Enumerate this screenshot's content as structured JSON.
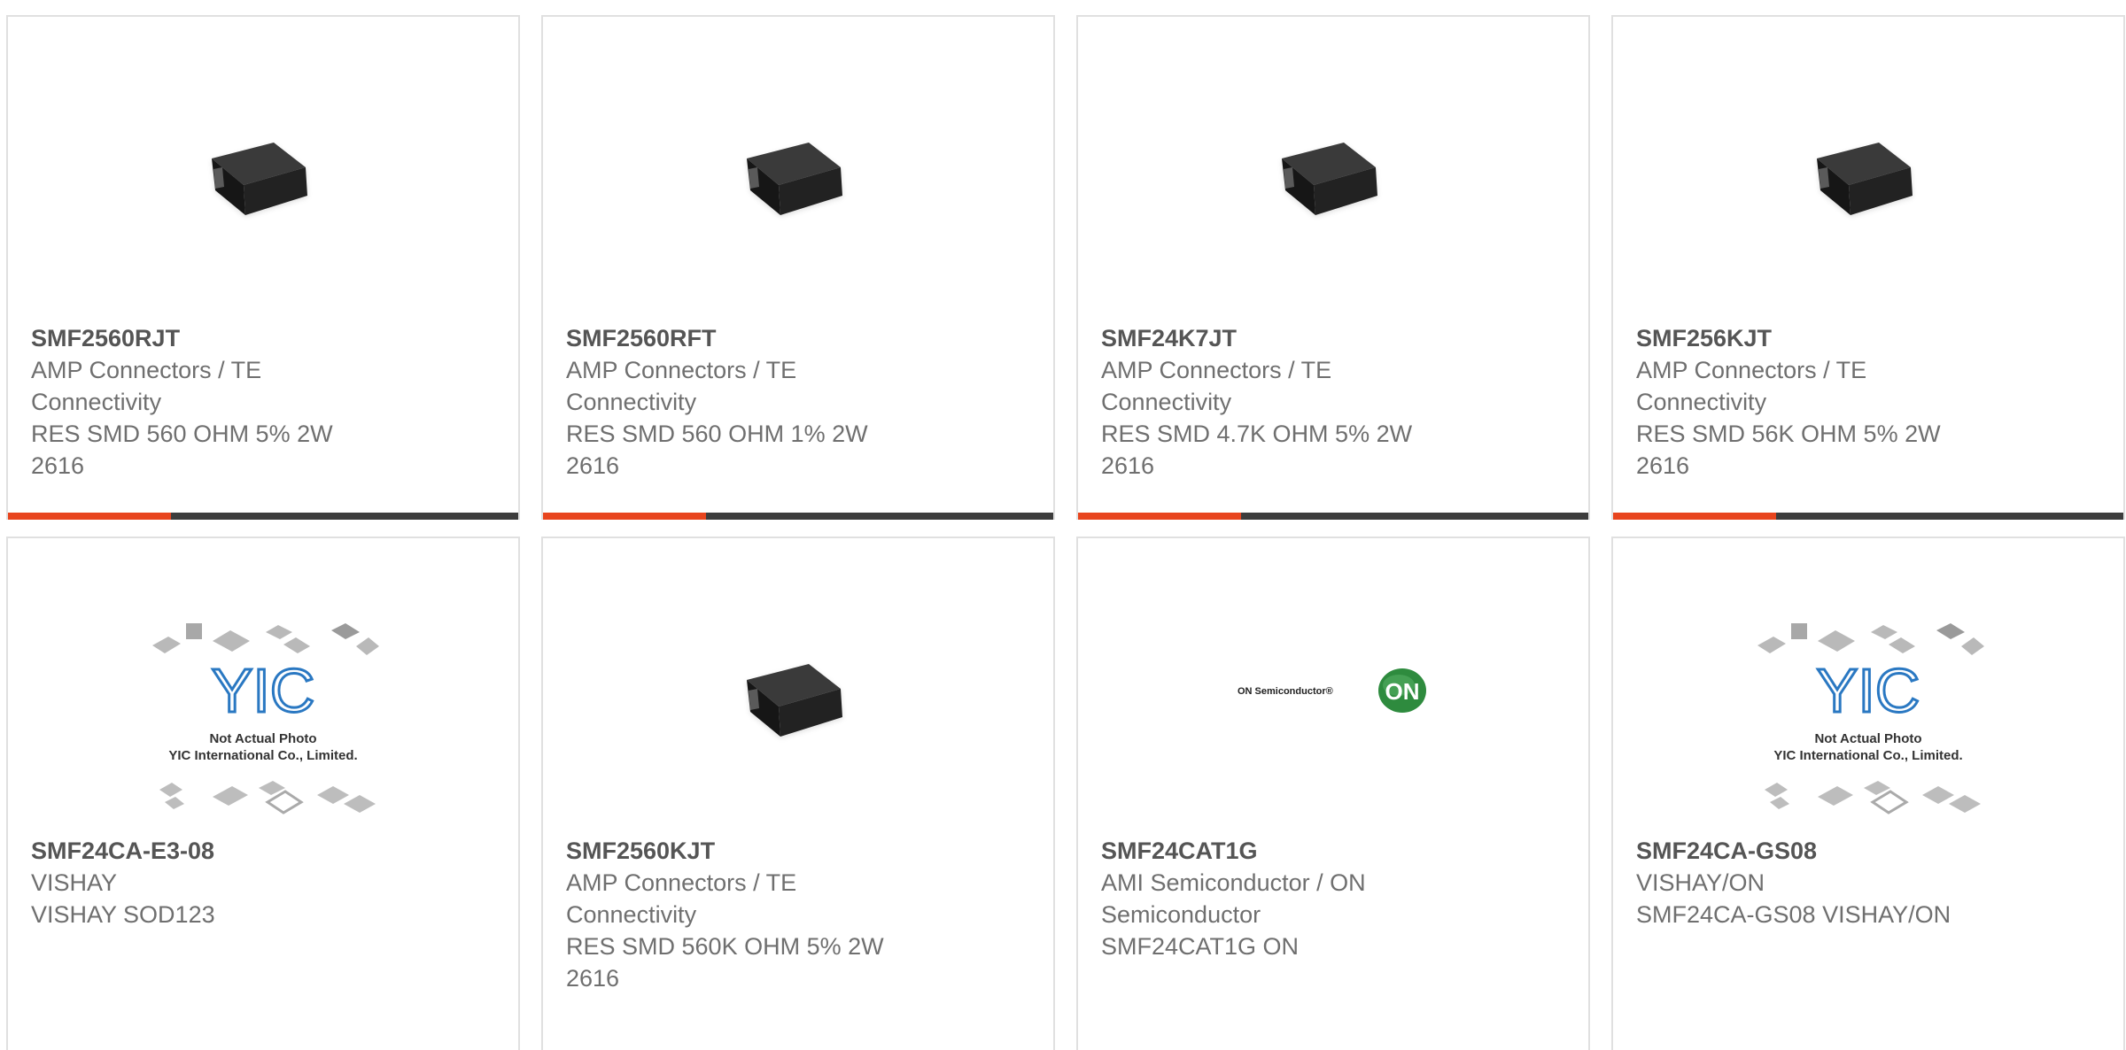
{
  "colors": {
    "accent": "#e8451e",
    "bar": "#3d3d3d",
    "border": "#e0e0e0",
    "title": "#555555",
    "text": "#6f6f6f"
  },
  "products": [
    {
      "part": "SMF2560RJT",
      "image": "smd-resistor",
      "lines": [
        "AMP Connectors / TE",
        "Connectivity",
        "RES SMD 560 OHM 5% 2W",
        "2616"
      ]
    },
    {
      "part": "SMF2560RFT",
      "image": "smd-resistor",
      "lines": [
        "AMP Connectors / TE",
        "Connectivity",
        "RES SMD 560 OHM 1% 2W",
        "2616"
      ]
    },
    {
      "part": "SMF24K7JT",
      "image": "smd-resistor",
      "lines": [
        "AMP Connectors / TE",
        "Connectivity",
        "RES SMD 4.7K OHM 5% 2W",
        "2616"
      ]
    },
    {
      "part": "SMF256KJT",
      "image": "smd-resistor",
      "lines": [
        "AMP Connectors / TE",
        "Connectivity",
        "RES SMD 56K OHM 5% 2W",
        "2616"
      ]
    },
    {
      "part": "SMF24CA-E3-08",
      "image": "placeholder",
      "placeholder": {
        "logo": "YIC",
        "caption1": "Not Actual Photo",
        "caption2": "YIC International Co., Limited."
      },
      "lines": [
        "VISHAY",
        "VISHAY SOD123"
      ]
    },
    {
      "part": "SMF2560KJT",
      "image": "smd-resistor",
      "lines": [
        "AMP Connectors / TE",
        "Connectivity",
        "RES SMD 560K OHM 5% 2W",
        "2616"
      ]
    },
    {
      "part": "SMF24CAT1G",
      "image": "on-logo",
      "logo": {
        "wordmark": "ON Semiconductor®",
        "badge": "ON"
      },
      "lines": [
        "AMI Semiconductor / ON",
        "Semiconductor",
        "SMF24CAT1G ON"
      ]
    },
    {
      "part": "SMF24CA-GS08",
      "image": "placeholder",
      "placeholder": {
        "logo": "YIC",
        "caption1": "Not Actual Photo",
        "caption2": "YIC International Co., Limited."
      },
      "lines": [
        "VISHAY/ON",
        "SMF24CA-GS08 VISHAY/ON"
      ]
    }
  ]
}
